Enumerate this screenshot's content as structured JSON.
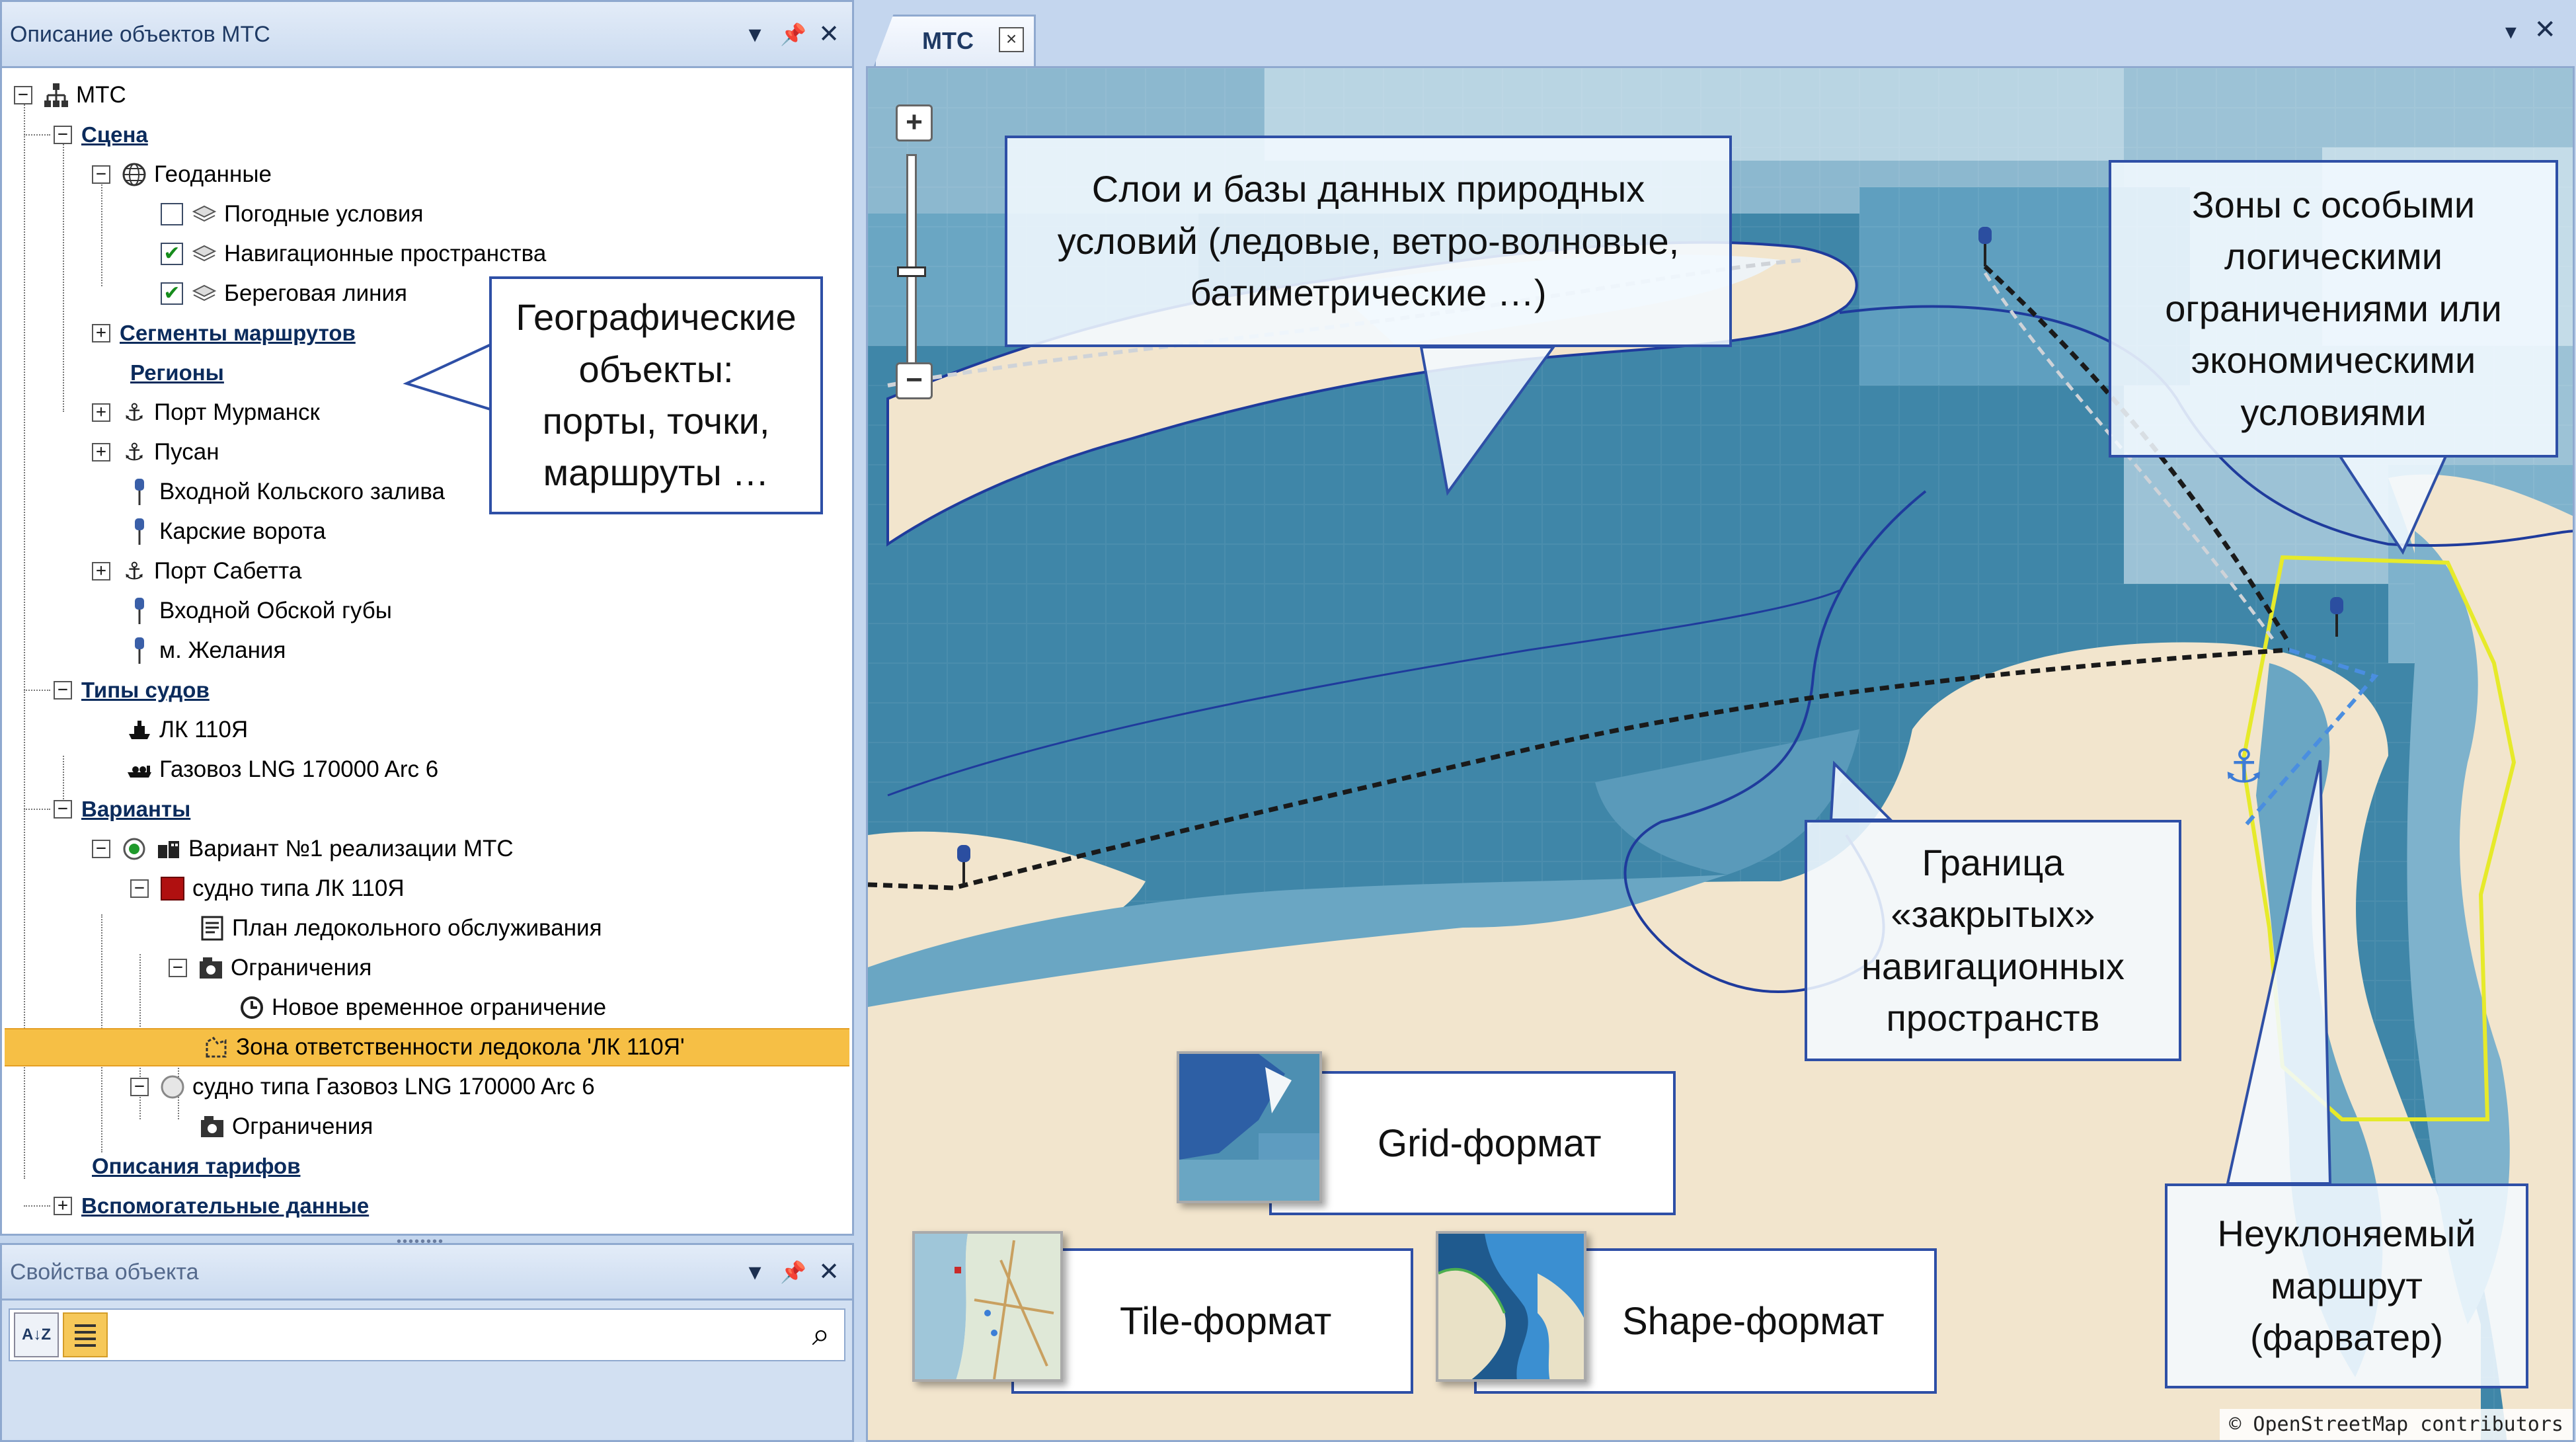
{
  "tree_panel": {
    "title": "Описание объектов МТС",
    "menu_icon": "▾",
    "pin_icon": "📌",
    "close_icon": "✕"
  },
  "tree": {
    "root": "МТС",
    "scene": "Сцена",
    "geodata": "Геоданные",
    "weather": "Погодные условия",
    "nav_spaces": "Навигационные пространства",
    "coastline": "Береговая линия",
    "route_segments": "Сегменты маршрутов",
    "regions": "Регионы",
    "port_murmansk": "Порт Мурманск",
    "busan": "Пусан",
    "kola_entrance": "Входной Кольского залива",
    "kara_gates": "Карские ворота",
    "port_sabetta": "Порт Сабетта",
    "ob_entrance": "Входной Обской губы",
    "cape_zhelaniya": "м. Желания",
    "ship_types": "Типы судов",
    "lk110": "ЛК 110Я",
    "lng_carrier": "Газовоз LNG 170000 Arc 6",
    "variants": "Варианты",
    "variant1": "Вариант №1 реализации МТС",
    "vessel_lk": "судно типа ЛК 110Я",
    "icebreaking_plan": "План ледокольного обслуживания",
    "restrictions": "Ограничения",
    "new_temp_restriction": "Новое временное ограничение",
    "responsibility_zone": "Зона ответственности ледокола 'ЛК 110Я'",
    "vessel_lng": "судно типа Газовоз LNG 170000 Arc 6",
    "restrictions2": "Ограничения",
    "tariffs": "Описания тарифов",
    "aux_data": "Вспомогательные данные"
  },
  "prop_panel": {
    "title": "Свойства объекта",
    "sort_az_label": "A↓Z",
    "search_value": ""
  },
  "document": {
    "tab_label": "МТС",
    "tab_close": "×",
    "menu_icon": "▾",
    "close_icon": "✕"
  },
  "map": {
    "zoom_in": "+",
    "zoom_out": "−",
    "attribution": "© OpenStreetMap contributors",
    "colors": {
      "sea_deep": "#3f86a8",
      "sea_mid": "#6aa6c3",
      "sea_light": "#a9cbdc",
      "land": "#f2e5cd",
      "ice": "#eaf1f5",
      "zone_yellow": "#e6ea2a",
      "boundary": "#1f3b9c"
    }
  },
  "callouts": {
    "nature_layers": "Слои и базы данных природных\nусловий (ледовые, ветро-волновые,\nбатиметрические …)",
    "geo_objects": "Географические\nобъекты:\nпорты, точки,\nмаршруты …",
    "special_zones": "Зоны с особыми\nлогическими\nограничениями или\nэкономическими\nусловиями",
    "closed_spaces": "Граница\n«закрытых»\nнавигационных\nпространств",
    "fairway": "Неуклоняемый\nмаршрут\n(фарватер)",
    "grid_format": "Grid-формат",
    "tile_format": "Tile-формат",
    "shape_format": "Shape-формат"
  }
}
